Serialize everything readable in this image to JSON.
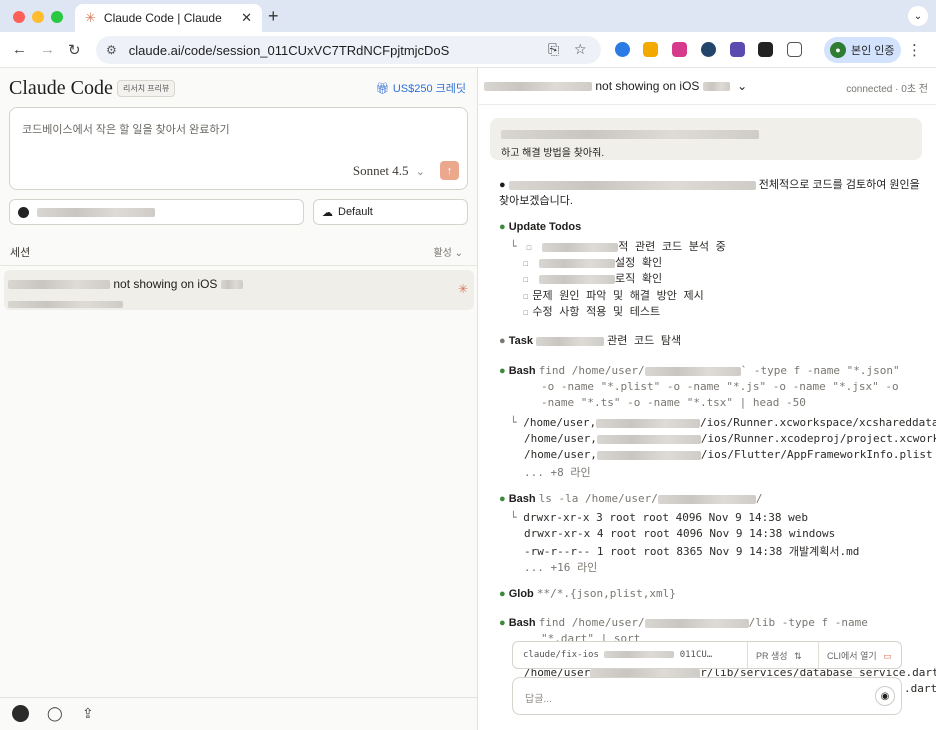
{
  "browser": {
    "tab_title": "Claude Code | Claude",
    "tab_close": "✕",
    "new_tab": "+",
    "url": "claude.ai/code/session_011CUxVC7TRdNCFpjtmjcDoS",
    "verify_label": "본인 인증"
  },
  "left": {
    "brand": "Claude Code",
    "preview_badge": "리서치 프리뷰",
    "credit": "US$250 크레딧",
    "prompt_placeholder": "코드베이스에서 작은 할 일을 찾아서 완료하기",
    "model": "Sonnet 4.5",
    "env_label": "Default",
    "sessions_heading": "세션",
    "sessions_filter": "활성 ⌄",
    "session_title_suffix": "not showing on iOS"
  },
  "right": {
    "header_title_suffix": "not showing on iOS",
    "status": "connected · 0초 전",
    "user_msg_line2": "하고 해결 방법을 찾아줘.",
    "assistant_intro_tail": "전체적으로 코드를 검토하여 원인을",
    "assistant_intro_line2": "찾아보겠습니다.",
    "todos_label": "Update Todos",
    "todos": [
      "적 관련 코드 분석 중",
      "설정 확인",
      "로직 확인",
      "문제 원인 파악 및 해결 방안 제시",
      "수정 사항 적용 및 테스트"
    ],
    "task_label": "Task",
    "task_text": "관련 코드 탐색",
    "bash1_label": "Bash",
    "bash1_cmd1": "find /home/user/",
    "bash1_cmd1_tail": "` -type f -name \"*.json\"",
    "bash1_cmd2": "-o -name \"*.plist\" -o -name \"*.js\" -o -name \"*.jsx\" -o",
    "bash1_cmd3": "-name \"*.ts\" -o -name \"*.tsx\" | head -50",
    "bash1_out1_pre": "/home/user,",
    "bash1_out1": "/ios/Runner.xcworkspace/xcshareddata",
    "bash1_out2_pre": "/home/user,",
    "bash1_out2": "/ios/Runner.xcodeproj/project.xcwork",
    "bash1_out3_pre": "/home/user,",
    "bash1_out3": "/ios/Flutter/AppFrameworkInfo.plist",
    "bash1_more": "... +8 라인",
    "bash2_label": "Bash",
    "bash2_cmd": "ls -la /home/user/",
    "bash2_cmd_tail": "/",
    "bash2_out": [
      "drwxr-xr-x  3 root root  4096 Nov  9 14:38 web",
      "drwxr-xr-x  4 root root  4096 Nov  9 14:38 windows",
      "-rw-r--r--  1 root root  8365 Nov  9 14:38 개발계획서.md"
    ],
    "bash2_more": "... +16 라인",
    "glob_label": "Glob",
    "glob_pattern": "**/*.{json,plist,xml}",
    "bash3_label": "Bash",
    "bash3_cmd1": "find /home/user/",
    "bash3_cmd1_tail": "/lib -type f -name",
    "bash3_cmd2": "\"*.dart\" | sort",
    "bash3_out1_pre": "/home/user",
    "bash3_out1": "r/lib/services/database_service.dart",
    "bash3_out2": ".dart",
    "branch": "claude/fix-ios",
    "branch_tail": "011CU…",
    "pr_label": "PR 생성",
    "cli_label": "CLI에서 열기",
    "reply_placeholder": "답글..."
  }
}
